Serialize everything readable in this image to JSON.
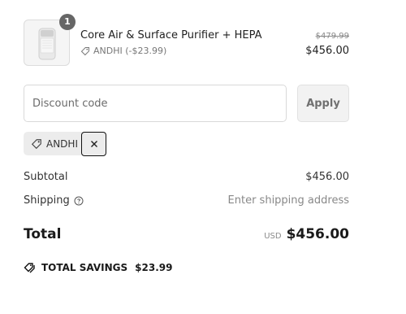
{
  "product": {
    "quantity": "1",
    "name": "Core Air & Surface Purifier + HEPA",
    "discount_line": "ANDHI (-$23.99)",
    "original_price": "$479.99",
    "price": "$456.00",
    "thumbnail_icon": "air-purifier-image"
  },
  "discount": {
    "placeholder": "Discount code",
    "apply_label": "Apply",
    "applied_code": "ANDHI"
  },
  "summary": {
    "subtotal_label": "Subtotal",
    "subtotal_value": "$456.00",
    "shipping_label": "Shipping",
    "shipping_value": "Enter shipping address",
    "total_label": "Total",
    "currency": "USD",
    "total_value": "$456.00"
  },
  "savings": {
    "label": "TOTAL SAVINGS",
    "amount": "$23.99"
  },
  "icons": {
    "tag": "tag-icon",
    "remove": "close-icon",
    "help": "question-circle-icon",
    "savings": "price-tags-icon"
  }
}
